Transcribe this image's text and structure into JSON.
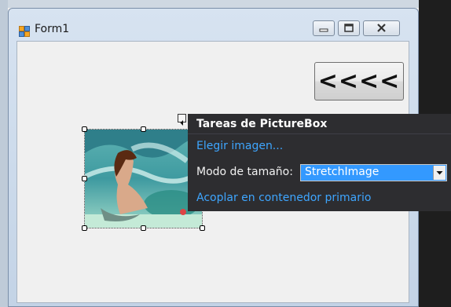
{
  "form": {
    "title": "Form1"
  },
  "main": {
    "nav_button_label": "<<<<"
  },
  "tasks_panel": {
    "title": "Tareas de PictureBox",
    "choose_image_link": "Elegir imagen...",
    "size_mode_label": "Modo de tamaño:",
    "size_mode_value": "StretchImage",
    "dock_link": "Acoplar en contenedor primario"
  },
  "icons": [
    "form-app-icon",
    "minimize-icon",
    "maximize-icon",
    "close-icon",
    "smart-tag-icon",
    "chevron-down-icon"
  ],
  "colors": {
    "panel_bg": "#2d2d30",
    "link": "#3ea6ff",
    "selection": "#3399ff"
  }
}
